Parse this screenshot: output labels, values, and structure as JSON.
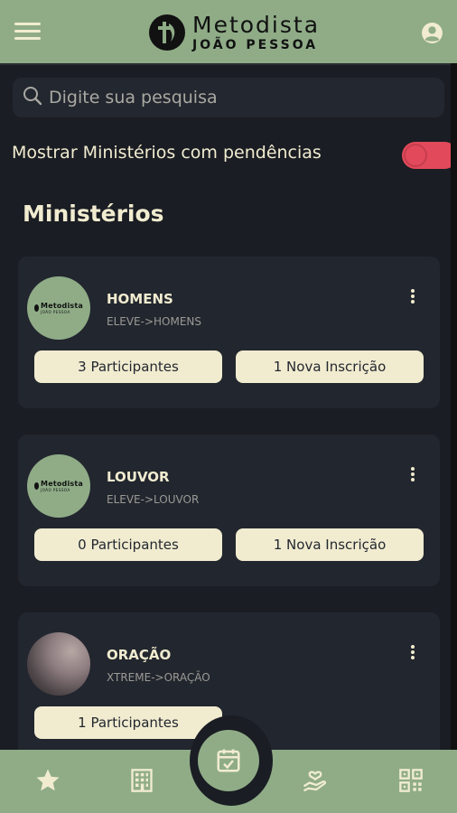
{
  "app": {
    "logo_title": "Metodista",
    "logo_subtitle": "JOÃO PESSOA"
  },
  "search": {
    "placeholder": "Digite sua pesquisa",
    "value": ""
  },
  "filter": {
    "label": "Mostrar Ministérios com pendências",
    "enabled": true
  },
  "section": {
    "title": "Ministérios"
  },
  "ministries": [
    {
      "name": "HOMENS",
      "path": "ELEVE->HOMENS",
      "participants": "3 Participantes",
      "new_signups": "1 Nova Inscrição",
      "avatar_logo_title": "Metodista",
      "avatar_logo_subtitle": "JOÃO PESSOA"
    },
    {
      "name": "LOUVOR",
      "path": "ELEVE->LOUVOR",
      "participants": "0 Participantes",
      "new_signups": "1 Nova Inscrição",
      "avatar_logo_title": "Metodista",
      "avatar_logo_subtitle": "JOÃO PESSOA"
    },
    {
      "name": "ORAÇÃO",
      "path": "XTREME->ORAÇÃO",
      "participants": "1 Participantes"
    }
  ],
  "icons": {
    "menu": "hamburger-menu-icon",
    "account": "account-circle-icon",
    "search": "search-icon",
    "more": "more-vertical-icon",
    "nav": [
      "star-icon",
      "building-icon",
      "calendar-check-icon",
      "hand-heart-icon",
      "qr-code-icon"
    ]
  },
  "colors": {
    "accent_green": "#8fac87",
    "background": "#1a1d23",
    "card": "#22262e",
    "cream": "#f1ecd0",
    "toggle_on": "#e24a5b"
  }
}
